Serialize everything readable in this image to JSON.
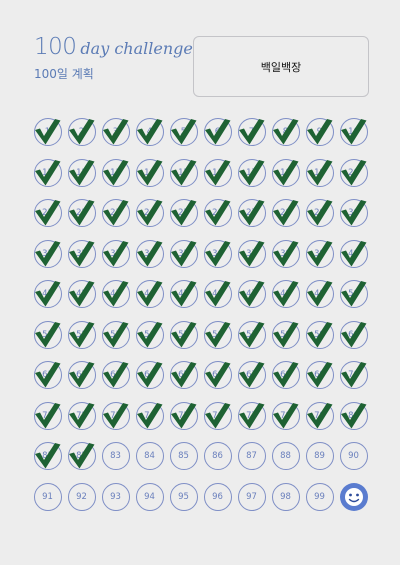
{
  "header": {
    "title_number": "100",
    "title_script": "day challenge",
    "subtitle": "100일 계획"
  },
  "goal_box": {
    "text": "백일백장"
  },
  "tracker": {
    "total_days": 100,
    "checked_days": 82,
    "final_icon": "smiley-face-icon",
    "check_color": "#1e6233",
    "circle_color": "#7f8fc6",
    "accent_color": "#5b7bb5"
  }
}
